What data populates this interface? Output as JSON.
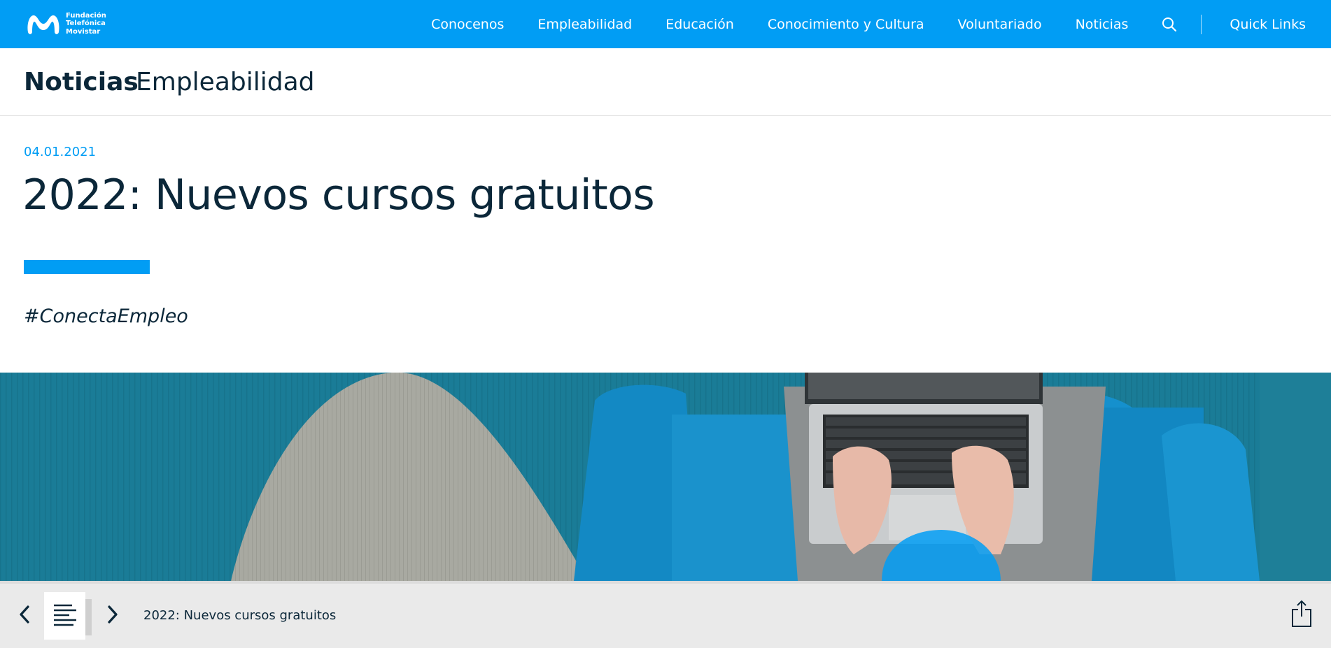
{
  "header": {
    "logo": {
      "line1": "Fundación",
      "line2": "Telefónica",
      "line3": "Movistar",
      "icon": "movistar-m-logo"
    },
    "nav_items": [
      "Conocenos",
      "Empleabilidad",
      "Educación",
      "Conocimiento y Cultura",
      "Voluntariado",
      "Noticias"
    ],
    "search_icon": "search-icon",
    "quick_links": "Quick Links"
  },
  "section": {
    "title": "Noticias",
    "subtitle": "Empleabilidad"
  },
  "article": {
    "date": "04.01.2021",
    "title": "2022: Nuevos cursos gratuitos",
    "hashtag": "#ConectaEmpleo"
  },
  "bottom_bar": {
    "prev_icon": "chevron-left-icon",
    "list_icon": "list-icon",
    "next_icon": "chevron-right-icon",
    "title": "2022: Nuevos cursos gratuitos",
    "share_icon": "share-icon"
  },
  "colors": {
    "brand_blue": "#019df4",
    "text_dark": "#0b2739",
    "bottom_bar_bg": "#eaeaea"
  }
}
